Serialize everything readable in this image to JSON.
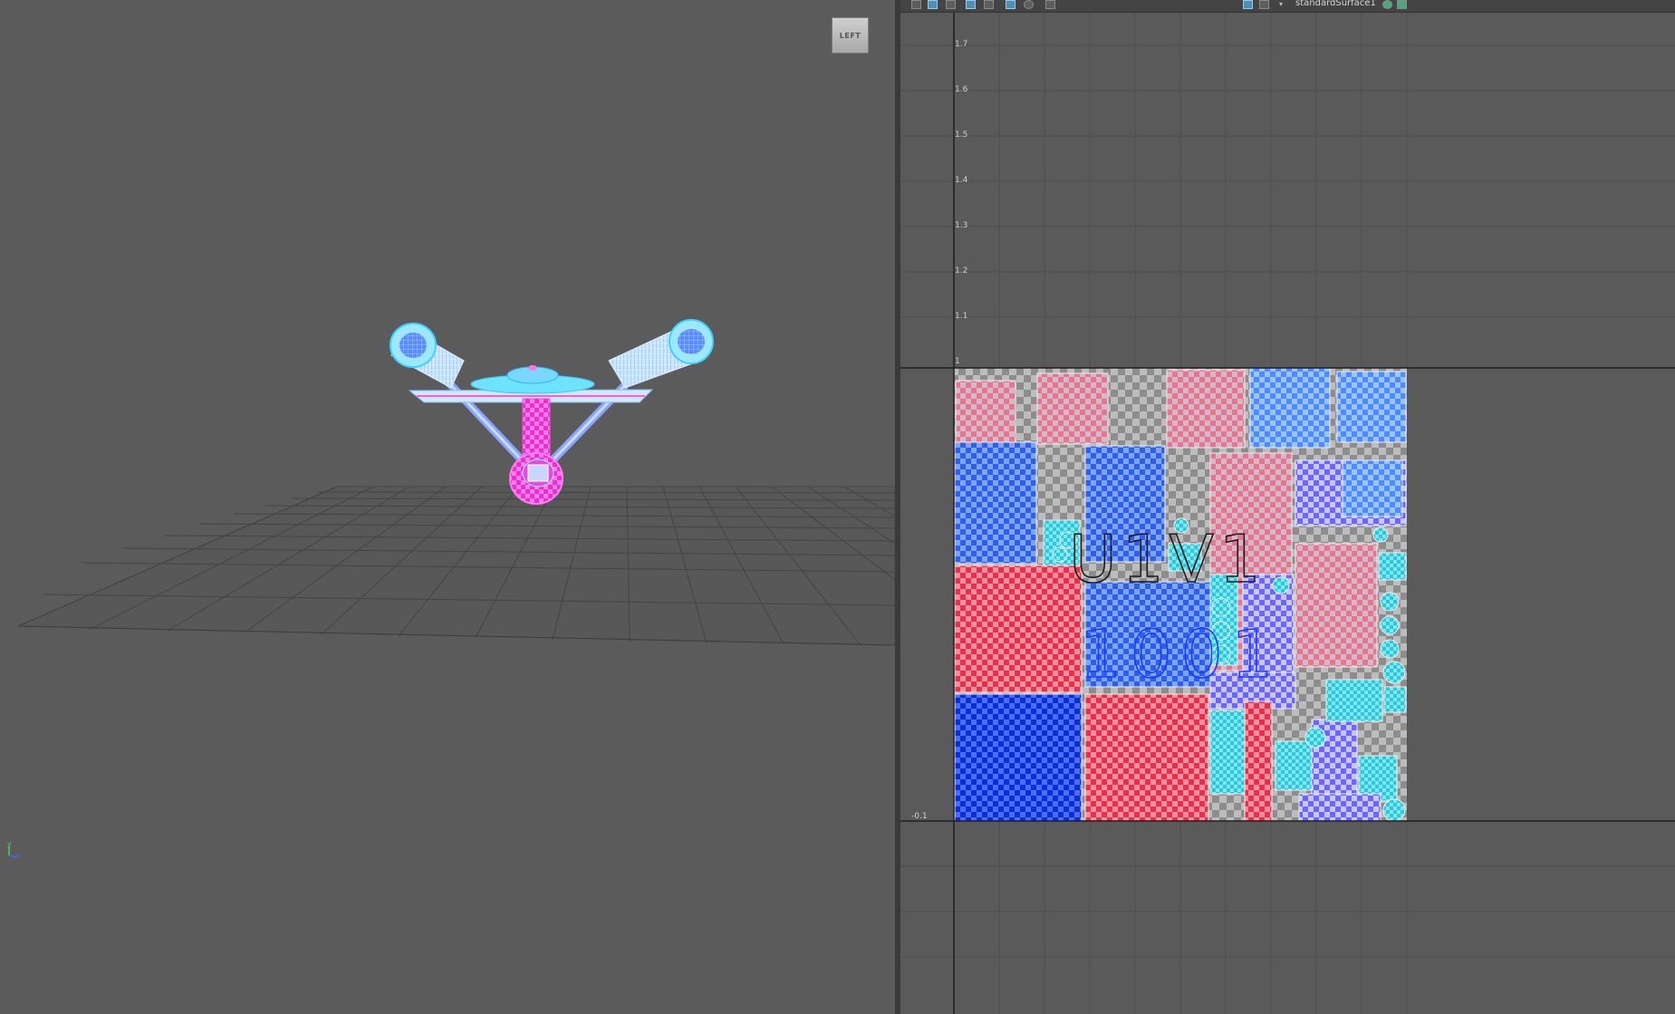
{
  "viewport": {
    "view_cube_label": "LEFT",
    "axis_labels": {
      "y": "y",
      "x": "x"
    }
  },
  "uv_editor": {
    "shader_name": "standardSurface1",
    "tick_labels": [
      "1.7",
      "1.6",
      "1.5",
      "1.4",
      "1.3",
      "1.2",
      "1.1",
      "1",
      "-0.1"
    ],
    "tile_label_line1": "U1V1",
    "tile_label_line2": "1001",
    "toolbar_icons": [
      "grid-icon",
      "image-display-icon",
      "texture-icon",
      "shaded-icon",
      "wireframe-icon",
      "tile-icon",
      "sphere-icon",
      "snapshot-icon",
      "checker-icon",
      "checker-map-icon",
      "dropdown-icon",
      "shader-icon",
      "settings-icon"
    ]
  },
  "colors": {
    "viewport_bg": "#5b5b5b",
    "uv_bg": "#5a5a5a",
    "wire_cyan": "#6de8ff",
    "wire_magenta": "#ff3dd8",
    "uv_red": "#e0344c",
    "uv_blue": "#2f5fe6",
    "uv_cyan": "#2ec6d8"
  }
}
